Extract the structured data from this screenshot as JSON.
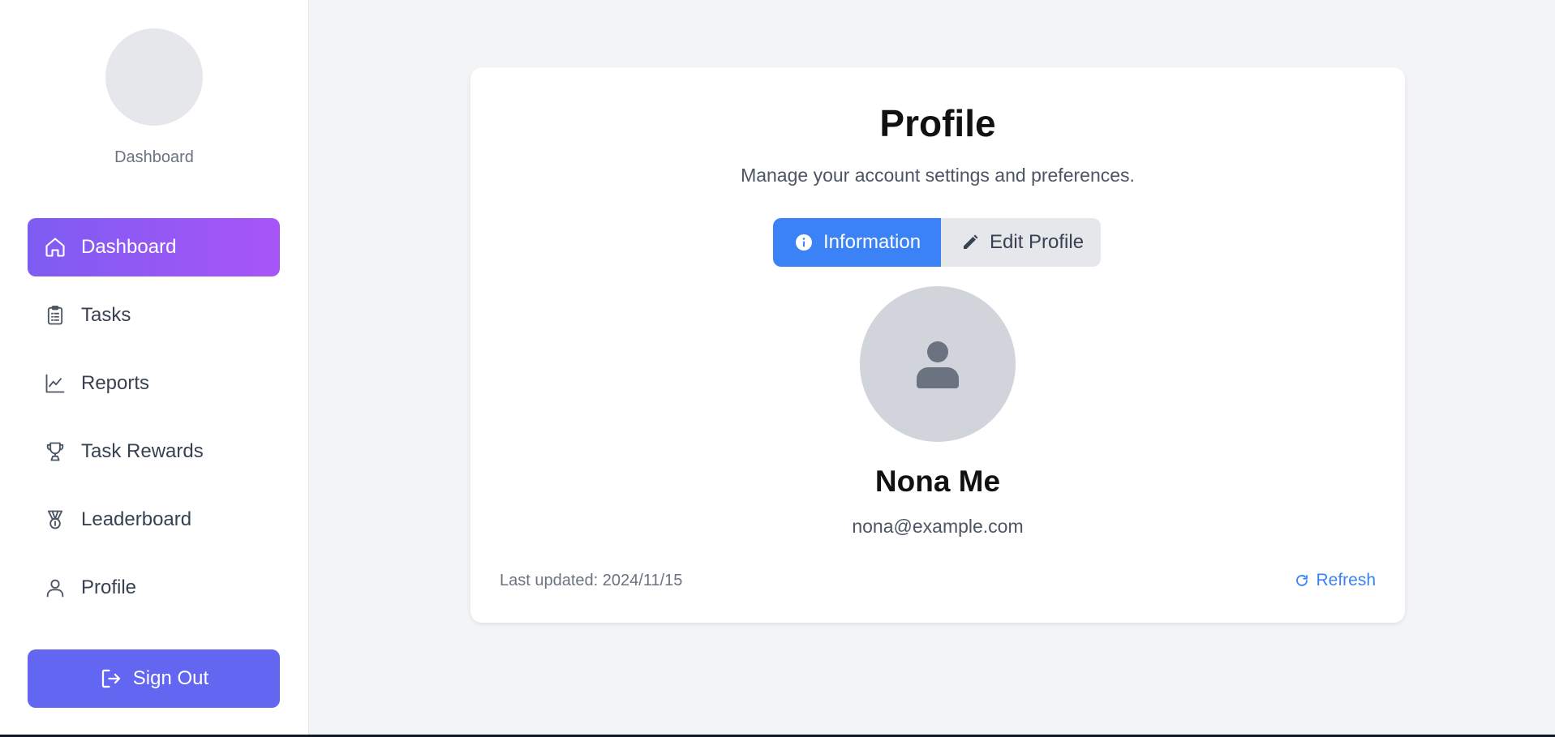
{
  "sidebar": {
    "brand": "Dashboard",
    "items": [
      {
        "label": "Dashboard",
        "icon": "home-icon",
        "active": true
      },
      {
        "label": "Tasks",
        "icon": "clipboard-icon"
      },
      {
        "label": "Reports",
        "icon": "line-chart-icon"
      },
      {
        "label": "Task Rewards",
        "icon": "trophy-icon"
      },
      {
        "label": "Leaderboard",
        "icon": "medal-icon"
      },
      {
        "label": "Profile",
        "icon": "user-icon"
      }
    ],
    "signout_label": "Sign Out"
  },
  "profile": {
    "title": "Profile",
    "subtitle": "Manage your account settings and preferences.",
    "tabs": [
      {
        "label": "Information",
        "icon": "info-icon",
        "active": true
      },
      {
        "label": "Edit Profile",
        "icon": "pencil-icon"
      }
    ],
    "name": "Nona Me",
    "email": "nona@example.com",
    "last_updated": "Last updated: 2024/11/15",
    "refresh_label": "Refresh"
  },
  "colors": {
    "active_gradient_start": "#7e5cf2",
    "active_gradient_end": "#a855f7",
    "signout": "#6366f1",
    "primary_blue": "#3b82f6",
    "page_bg": "#f3f4f6"
  }
}
